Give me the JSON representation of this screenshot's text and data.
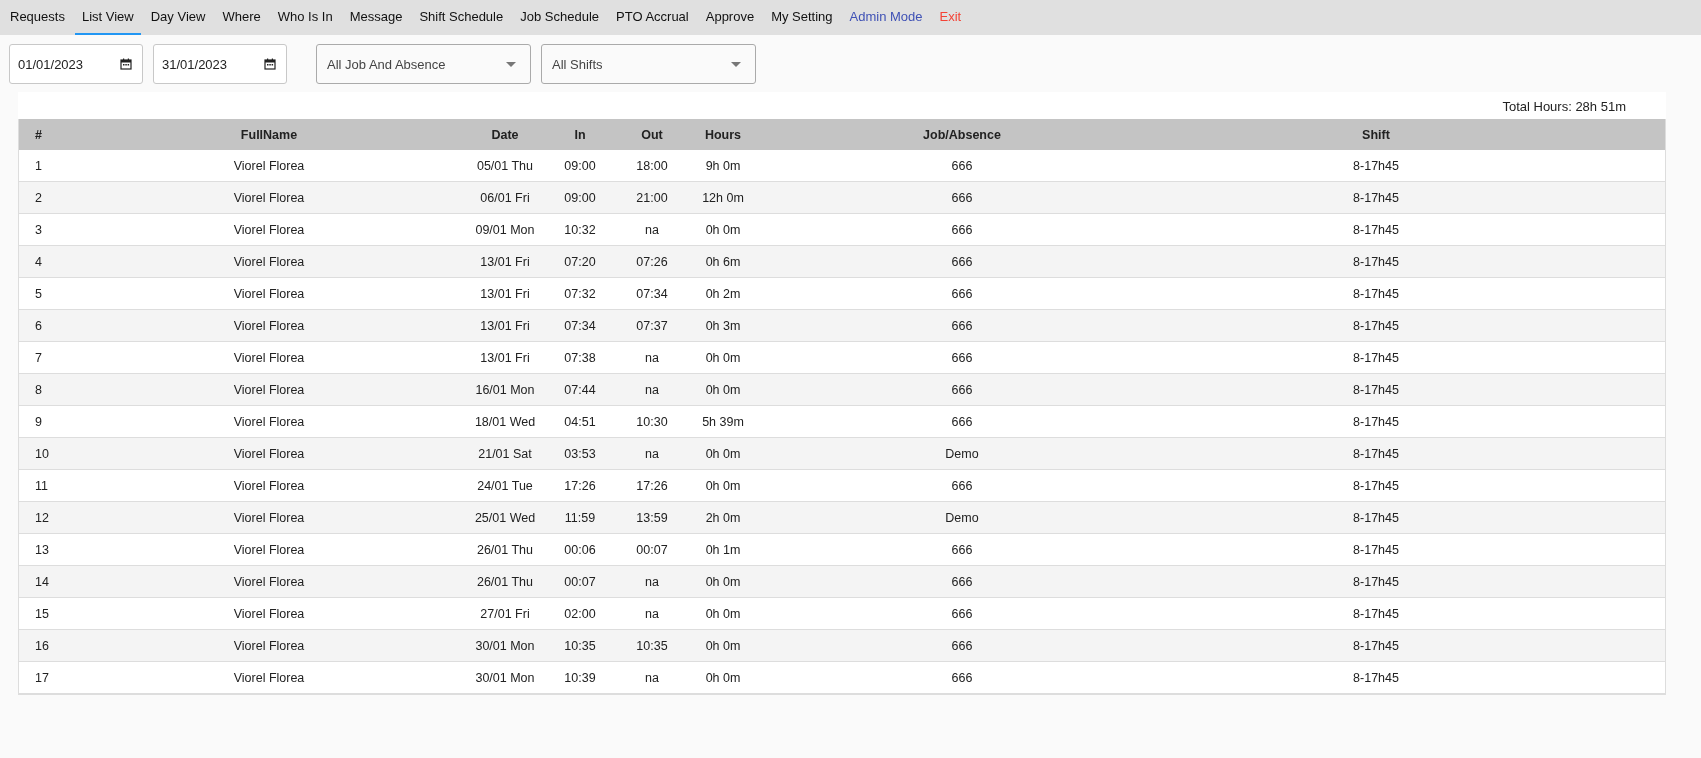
{
  "nav": [
    {
      "label": "Requests",
      "kind": "tab",
      "selected": false
    },
    {
      "label": "List View",
      "kind": "tab",
      "selected": true
    },
    {
      "label": "Day View",
      "kind": "tab",
      "selected": false
    },
    {
      "label": "Where",
      "kind": "tab",
      "selected": false
    },
    {
      "label": "Who Is In",
      "kind": "tab",
      "selected": false
    },
    {
      "label": "Message",
      "kind": "tab",
      "selected": false
    },
    {
      "label": "Shift Schedule",
      "kind": "tab",
      "selected": false
    },
    {
      "label": "Job Schedule",
      "kind": "tab",
      "selected": false
    },
    {
      "label": "PTO Accrual",
      "kind": "tab",
      "selected": false
    },
    {
      "label": "Approve",
      "kind": "tab",
      "selected": false
    },
    {
      "label": "My Setting",
      "kind": "tab",
      "selected": false
    },
    {
      "label": "Admin Mode",
      "kind": "admin",
      "selected": false
    },
    {
      "label": "Exit",
      "kind": "exit",
      "selected": false
    }
  ],
  "filters": {
    "date_from": "01/01/2023",
    "date_to": "31/01/2023",
    "job_filter": "All Job And Absence",
    "shift_filter": "All Shifts"
  },
  "total_hours": "Total Hours: 28h 51m",
  "table": {
    "columns": [
      "#",
      "FullName",
      "Date",
      "In",
      "Out",
      "Hours",
      "Job/Absence",
      "Shift"
    ],
    "rows": [
      [
        "1",
        "Viorel Florea",
        "05/01 Thu",
        "09:00",
        "18:00",
        "9h 0m",
        "666",
        "8-17h45"
      ],
      [
        "2",
        "Viorel Florea",
        "06/01 Fri",
        "09:00",
        "21:00",
        "12h 0m",
        "666",
        "8-17h45"
      ],
      [
        "3",
        "Viorel Florea",
        "09/01 Mon",
        "10:32",
        "na",
        "0h 0m",
        "666",
        "8-17h45"
      ],
      [
        "4",
        "Viorel Florea",
        "13/01 Fri",
        "07:20",
        "07:26",
        "0h 6m",
        "666",
        "8-17h45"
      ],
      [
        "5",
        "Viorel Florea",
        "13/01 Fri",
        "07:32",
        "07:34",
        "0h 2m",
        "666",
        "8-17h45"
      ],
      [
        "6",
        "Viorel Florea",
        "13/01 Fri",
        "07:34",
        "07:37",
        "0h 3m",
        "666",
        "8-17h45"
      ],
      [
        "7",
        "Viorel Florea",
        "13/01 Fri",
        "07:38",
        "na",
        "0h 0m",
        "666",
        "8-17h45"
      ],
      [
        "8",
        "Viorel Florea",
        "16/01 Mon",
        "07:44",
        "na",
        "0h 0m",
        "666",
        "8-17h45"
      ],
      [
        "9",
        "Viorel Florea",
        "18/01 Wed",
        "04:51",
        "10:30",
        "5h 39m",
        "666",
        "8-17h45"
      ],
      [
        "10",
        "Viorel Florea",
        "21/01 Sat",
        "03:53",
        "na",
        "0h 0m",
        "Demo",
        "8-17h45"
      ],
      [
        "11",
        "Viorel Florea",
        "24/01 Tue",
        "17:26",
        "17:26",
        "0h 0m",
        "666",
        "8-17h45"
      ],
      [
        "12",
        "Viorel Florea",
        "25/01 Wed",
        "11:59",
        "13:59",
        "2h 0m",
        "Demo",
        "8-17h45"
      ],
      [
        "13",
        "Viorel Florea",
        "26/01 Thu",
        "00:06",
        "00:07",
        "0h 1m",
        "666",
        "8-17h45"
      ],
      [
        "14",
        "Viorel Florea",
        "26/01 Thu",
        "00:07",
        "na",
        "0h 0m",
        "666",
        "8-17h45"
      ],
      [
        "15",
        "Viorel Florea",
        "27/01 Fri",
        "02:00",
        "na",
        "0h 0m",
        "666",
        "8-17h45"
      ],
      [
        "16",
        "Viorel Florea",
        "30/01 Mon",
        "10:35",
        "10:35",
        "0h 0m",
        "666",
        "8-17h45"
      ],
      [
        "17",
        "Viorel Florea",
        "30/01 Mon",
        "10:39",
        "na",
        "0h 0m",
        "666",
        "8-17h45"
      ]
    ]
  }
}
